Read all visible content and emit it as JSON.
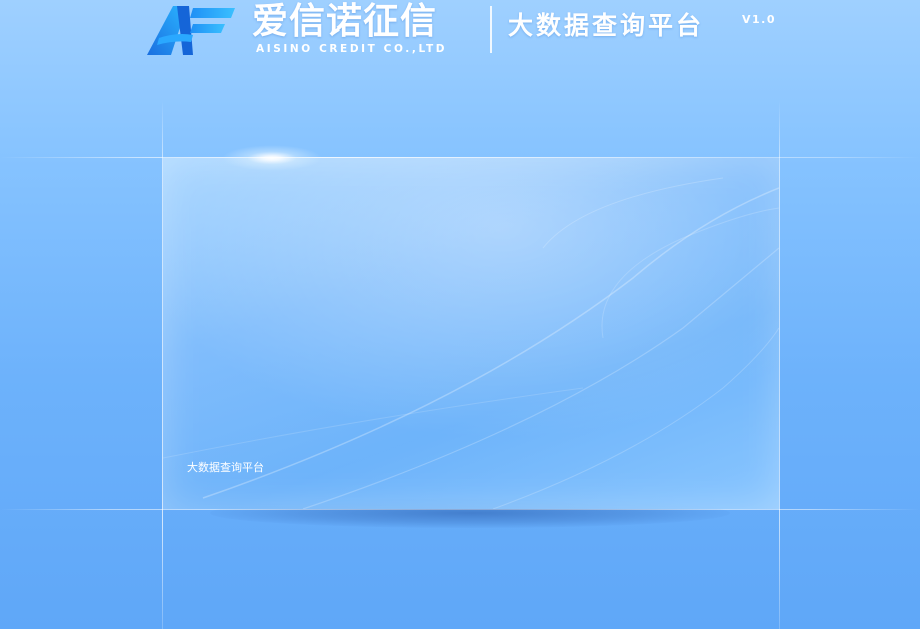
{
  "header": {
    "logo_icon": "aisino-logo-icon",
    "brand_cn": "爱信诺征信",
    "brand_en": "AISINO CREDIT CO.,LTD",
    "platform_title": "大数据查询平台",
    "version": "V1.0"
  },
  "panel": {
    "caption": "大数据查询平台"
  },
  "colors": {
    "background_top": "#9fd0ff",
    "background_bottom": "#5fa7f8",
    "logo_blue": "#1e8cf0",
    "text": "#ffffff"
  }
}
